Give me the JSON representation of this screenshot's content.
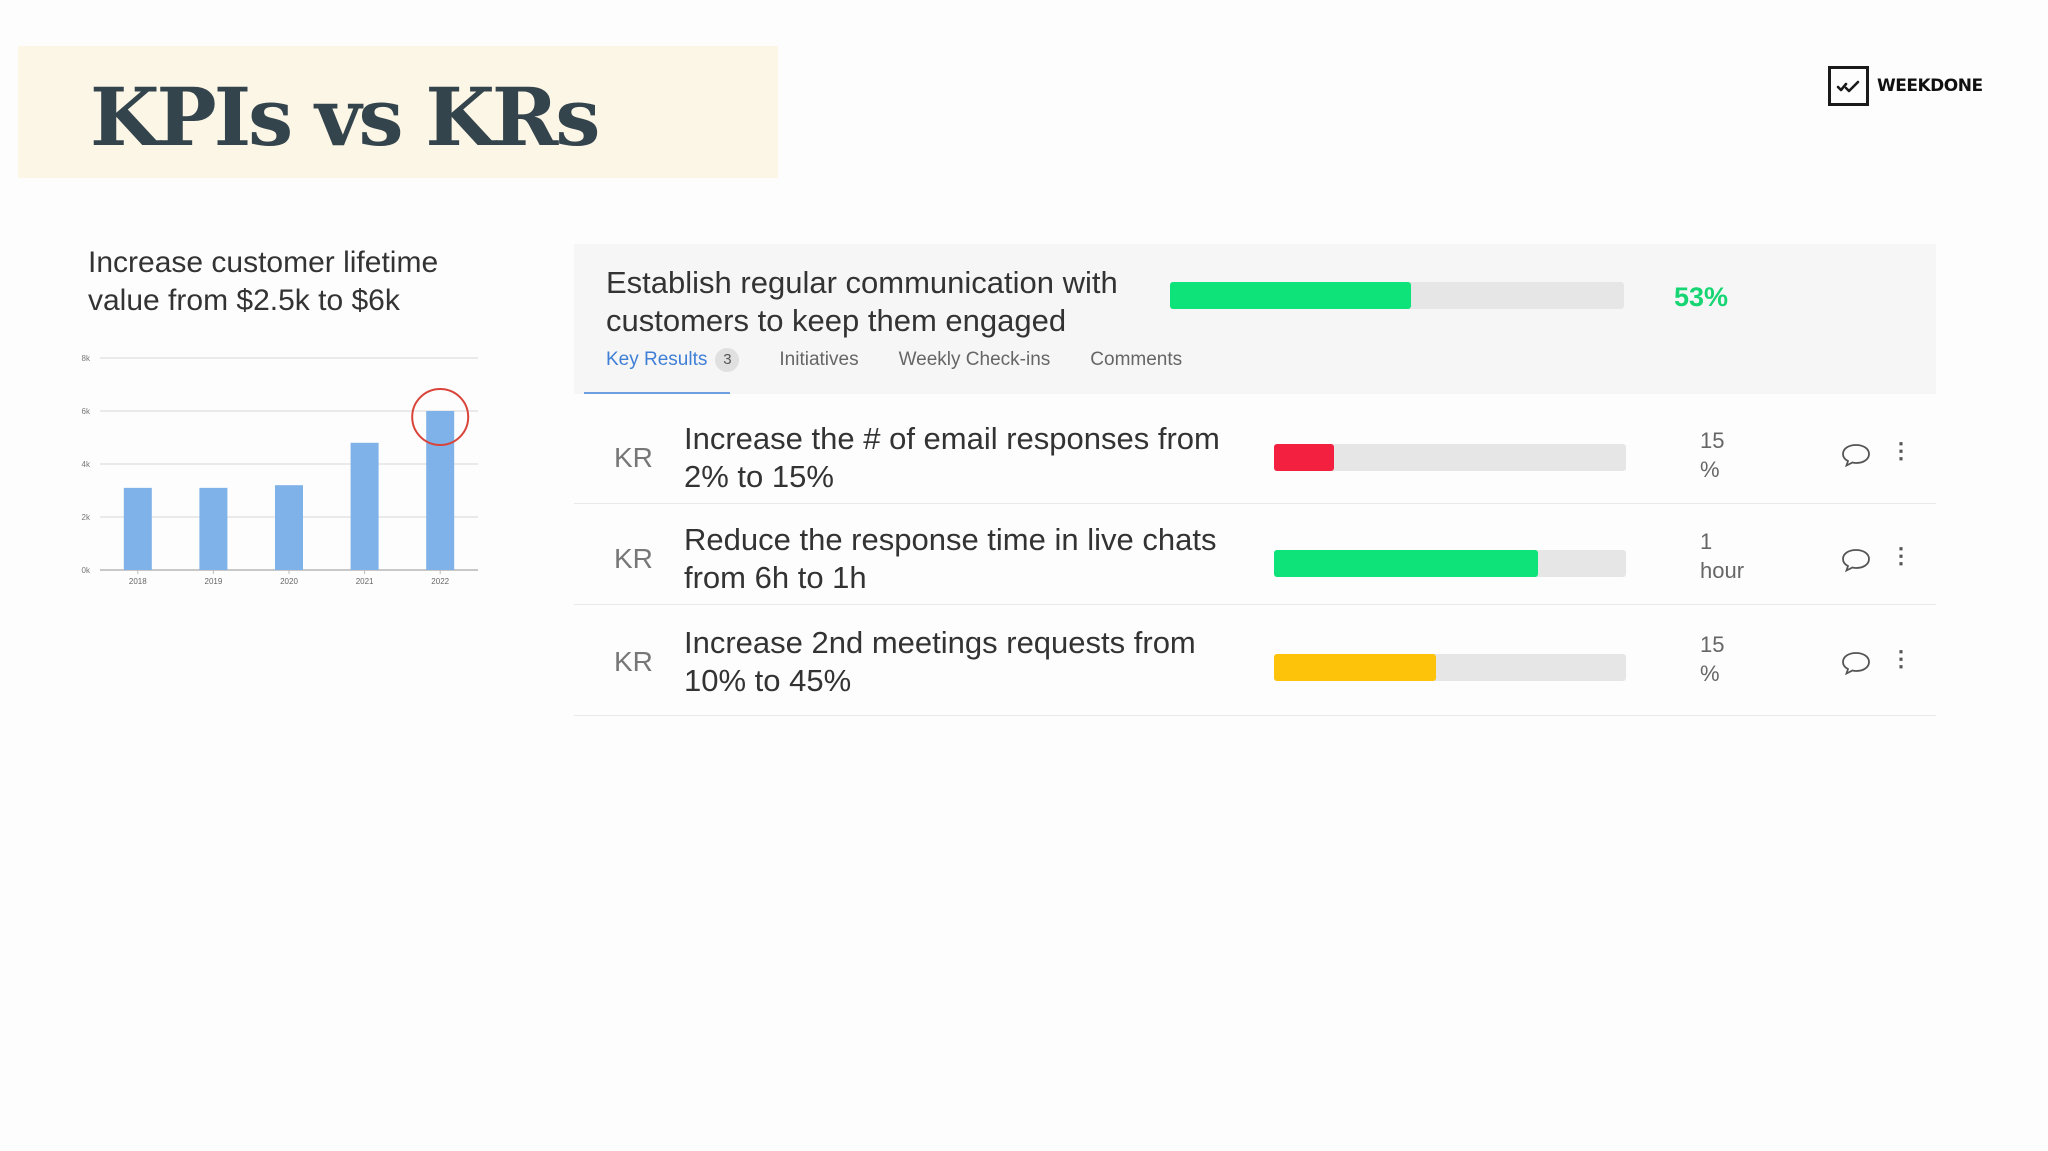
{
  "page": {
    "title": "KPIs vs KRs",
    "logo_text": "WEEKDONE"
  },
  "kpi": {
    "text": "Increase customer lifetime value from $2.5k to $6k"
  },
  "chart_data": {
    "type": "bar",
    "categories": [
      "2018",
      "2019",
      "2020",
      "2021",
      "2022"
    ],
    "values": [
      3.1,
      3.1,
      3.2,
      4.8,
      6.0
    ],
    "y_ticks": [
      "0k",
      "2k",
      "4k",
      "6k",
      "8k"
    ],
    "ylim": [
      0,
      8
    ],
    "grid": true,
    "bar_color": "#7fb2e8",
    "highlight": {
      "category": "2022",
      "color": "#d9443a"
    }
  },
  "objective": {
    "title": "Establish regular communication with customers to keep them engaged",
    "progress": 0.53,
    "progress_label": "53%",
    "color": "#0ee37a",
    "tabs": [
      {
        "label": "Key Results",
        "count": "3"
      },
      {
        "label": "Initiatives"
      },
      {
        "label": "Weekly Check-ins"
      },
      {
        "label": "Comments"
      }
    ]
  },
  "key_results": [
    {
      "tag": "KR",
      "title": "Increase the # of email responses from 2% to 15%",
      "progress": 0.17,
      "color": "#f3203f",
      "value": "15",
      "unit": "%"
    },
    {
      "tag": "KR",
      "title": "Reduce the response time in live chats from 6h to 1h",
      "progress": 0.75,
      "color": "#0ee37a",
      "value": "1",
      "unit": "hour"
    },
    {
      "tag": "KR",
      "title": "Increase 2nd meetings requests from 10% to 45%",
      "progress": 0.46,
      "color": "#fcc30a",
      "value": "15",
      "unit": "%"
    }
  ],
  "icons": {
    "logo": "check-chart-icon",
    "comment": "speech-bubble-icon",
    "more": "vertical-dots-icon"
  }
}
